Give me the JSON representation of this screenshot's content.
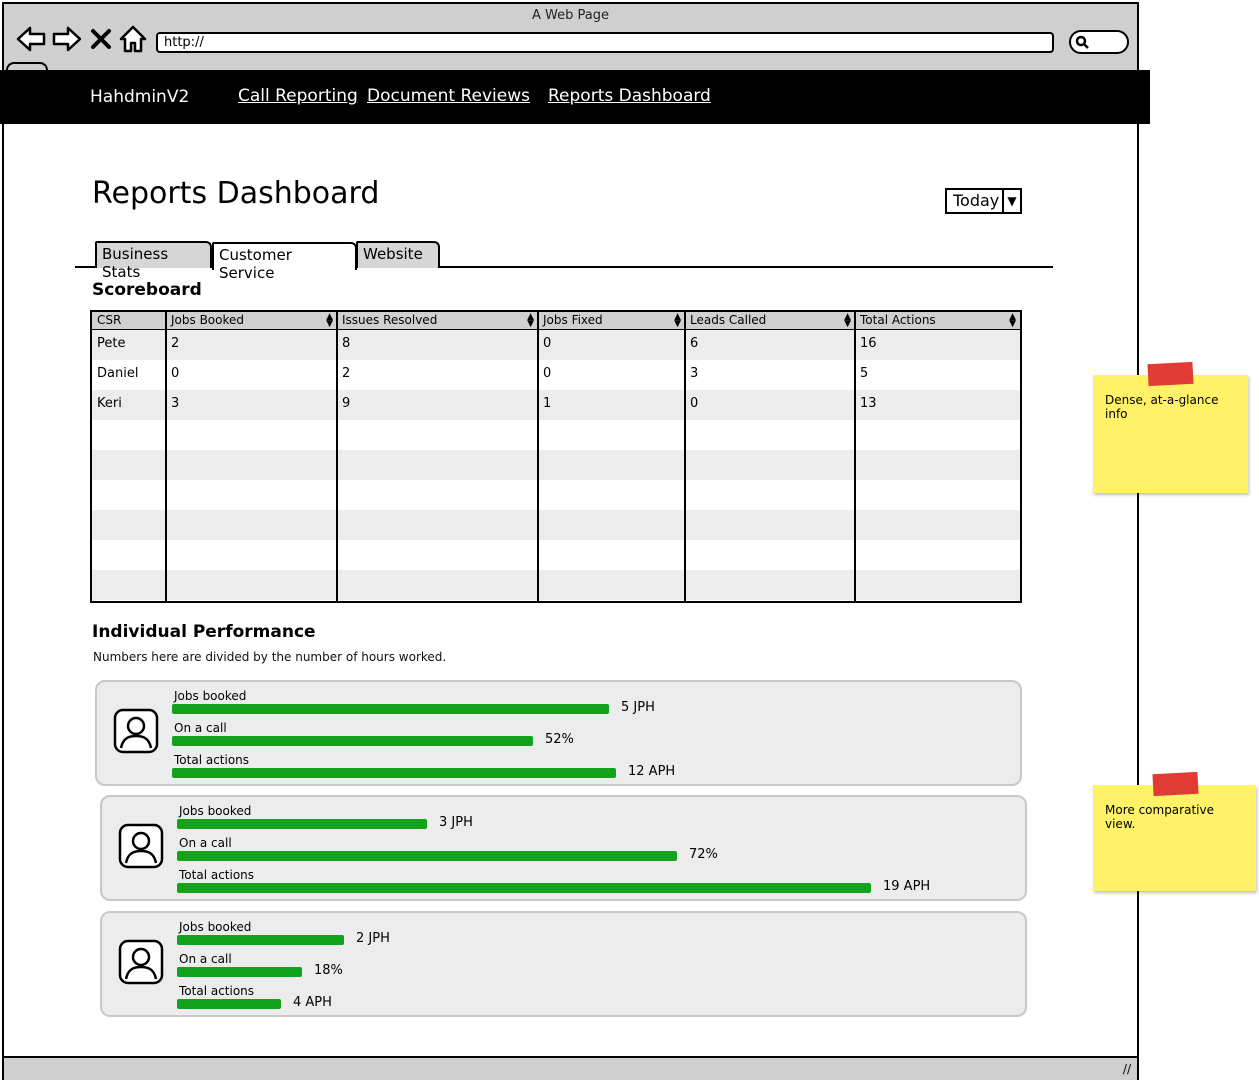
{
  "window": {
    "title": "A Web Page",
    "url": "http://"
  },
  "nav": {
    "brand": "HahdminV2",
    "links": [
      "Call Reporting",
      "Document Reviews",
      "Reports Dashboard"
    ]
  },
  "page": {
    "title": "Reports Dashboard",
    "date_filter": "Today"
  },
  "tabs": [
    {
      "label": "Business Stats",
      "active": false
    },
    {
      "label": "Customer Service",
      "active": true
    },
    {
      "label": "Website",
      "active": false
    }
  ],
  "scoreboard": {
    "title": "Scoreboard",
    "columns": [
      "CSR",
      "Jobs Booked",
      "Issues Resolved",
      "Jobs Fixed",
      "Leads Called",
      "Total Actions"
    ],
    "rows": [
      [
        "Pete",
        "2",
        "8",
        "0",
        "6",
        "16"
      ],
      [
        "Daniel",
        "0",
        "2",
        "0",
        "3",
        "5"
      ],
      [
        "Keri",
        "3",
        "9",
        "1",
        "0",
        "13"
      ]
    ]
  },
  "performance": {
    "title": "Individual Performance",
    "note": "Numbers here are divided by the number of hours worked.",
    "people": [
      {
        "metrics": [
          {
            "label": "Jobs booked",
            "value": "5 JPH",
            "fraction": 0.63
          },
          {
            "label": "On a call",
            "value": "52%",
            "fraction": 0.52
          },
          {
            "label": "Total actions",
            "value": "12 APH",
            "fraction": 0.64
          }
        ]
      },
      {
        "metrics": [
          {
            "label": "Jobs booked",
            "value": "3 JPH",
            "fraction": 0.36
          },
          {
            "label": "On a call",
            "value": "72%",
            "fraction": 0.72
          },
          {
            "label": "Total actions",
            "value": "19 APH",
            "fraction": 1.0
          }
        ]
      },
      {
        "metrics": [
          {
            "label": "Jobs booked",
            "value": "2 JPH",
            "fraction": 0.24
          },
          {
            "label": "On a call",
            "value": "18%",
            "fraction": 0.18
          },
          {
            "label": "Total actions",
            "value": "4 APH",
            "fraction": 0.15
          }
        ]
      }
    ]
  },
  "stickies": [
    {
      "text": "Dense, at-a-glance info"
    },
    {
      "text": "More comparative view."
    }
  ],
  "colors": {
    "bar": "#12a21c",
    "sticky": "#fff266",
    "tape": "#e03c35",
    "navbar": "#000000"
  }
}
